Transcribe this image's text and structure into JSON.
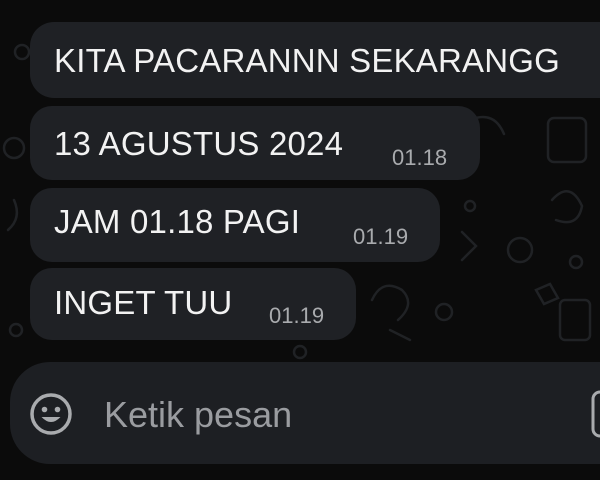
{
  "colors": {
    "background": "#0b0b0b",
    "bubble": "#1f2125",
    "composer": "#1d1f23",
    "text": "#f2f2f2",
    "timestamp": "#a9abae",
    "placeholder": "#9a9ca0"
  },
  "messages": [
    {
      "text": "KITA PACARANNN SEKARANGG",
      "time": ""
    },
    {
      "text": "13 AGUSTUS 2024",
      "time": "01.18"
    },
    {
      "text": "JAM 01.18 PAGI",
      "time": "01.19"
    },
    {
      "text": "INGET TUU",
      "time": "01.19"
    }
  ],
  "composer": {
    "placeholder": "Ketik pesan",
    "emoji_icon": "smiley-icon",
    "attach_icon": "attachment-icon"
  }
}
